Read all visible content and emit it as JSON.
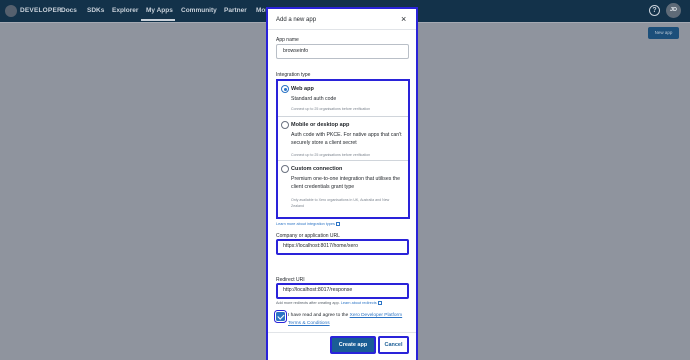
{
  "nav": {
    "brand": "DEVELOPER",
    "items": [
      "Docs",
      "SDKs",
      "Explorer",
      "My Apps",
      "Community",
      "Partner",
      "Mor"
    ],
    "active": "My Apps",
    "help": "?",
    "avatar": "JD"
  },
  "background": {
    "new_app_button": "New app"
  },
  "modal": {
    "title": "Add a new app",
    "close": "×",
    "app_name": {
      "label": "App name",
      "value": "browseinfo"
    },
    "integration": {
      "label": "Integration type",
      "selected": "Web app",
      "options": [
        {
          "title": "Web app",
          "desc": "Standard auth code",
          "note": "Connect up to 25 organisations before verification",
          "checked": true
        },
        {
          "title": "Mobile or desktop app",
          "desc": "Auth code with PKCE. For native apps that can't securely store a client secret",
          "note": "Connect up to 25 organisations before verification",
          "checked": false
        },
        {
          "title": "Custom connection",
          "desc": "Premium one-to-one integration that utilises the client credentials grant type",
          "note": "Only available to Xero organisations in UK, Australia and New Zealand",
          "checked": false
        }
      ],
      "learn_more": "Learn more about integration types"
    },
    "company_url": {
      "label": "Company or application URL",
      "value": "https://localhost:8017/home/xero"
    },
    "redirect_uri": {
      "label": "Redirect URI",
      "value": "http://localhost:8017/response",
      "hint": "Add more redirects after creating app.",
      "hint_link": "Learn about redirects"
    },
    "agree": {
      "text": "I have read and agree to the",
      "terms": "Xero Developer Platform Terms & Conditions",
      "checked": true
    },
    "create_button": "Create app",
    "cancel_button": "Cancel"
  },
  "colors": {
    "nav_bg": "#13324a",
    "overlay_bg": "#8f949e",
    "focus_outline": "#2a23d9",
    "primary": "#1a5d95",
    "link": "#2b74c5"
  }
}
